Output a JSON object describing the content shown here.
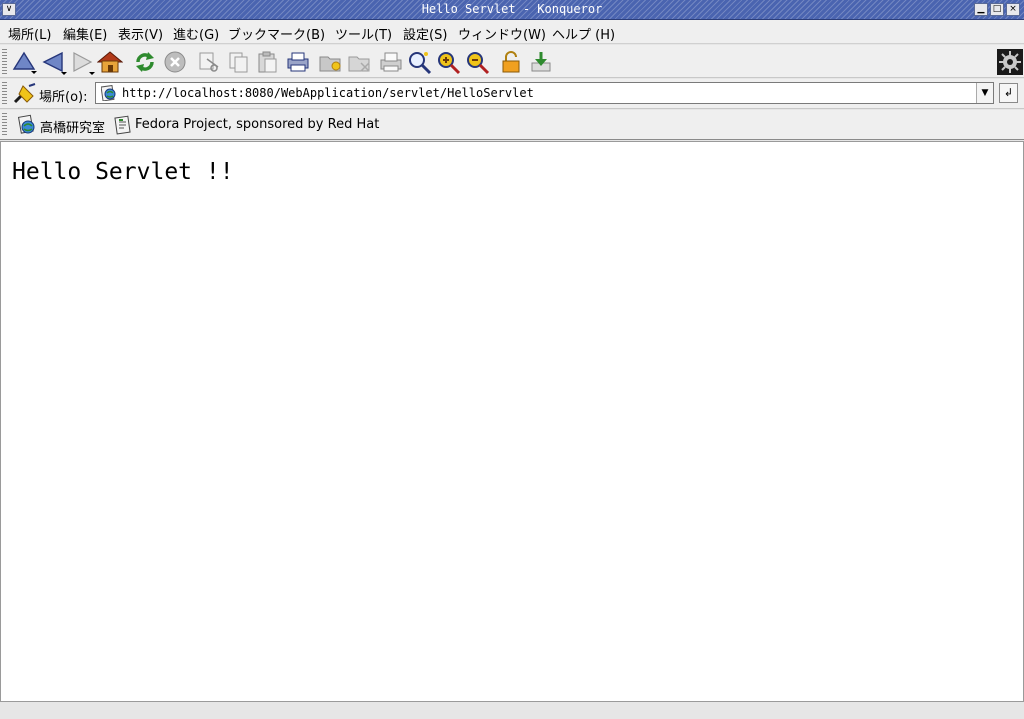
{
  "window": {
    "title": "Hello Servlet - Konqueror",
    "controls": {
      "menu": "∨",
      "minimize": "▁",
      "maximize": "□",
      "close": "×"
    }
  },
  "menubar": {
    "items": [
      "場所(L)",
      "編集(E)",
      "表示(V)",
      "進む(G)",
      "ブックマーク(B)",
      "ツール(T)",
      "設定(S)",
      "ウィンドウ(W)",
      "ヘルプ (H)"
    ]
  },
  "toolbar": {
    "icons": [
      "up-icon",
      "back-icon",
      "forward-icon",
      "home-icon",
      "reload-icon",
      "stop-icon",
      "cut-icon",
      "copy-icon",
      "paste-icon",
      "print-icon",
      "folder-new-icon",
      "folder-icon",
      "printer-icon",
      "find-icon",
      "zoom-in-icon",
      "zoom-out-icon",
      "security-lock-icon",
      "download-icon",
      "throbber-icon"
    ]
  },
  "locationbar": {
    "label": "場所(o):",
    "url": "http://localhost:8080/WebApplication/servlet/HelloServlet",
    "dropdown": "▼",
    "go": "↲"
  },
  "bookmarks": {
    "items": [
      {
        "label": "高橋研究室",
        "icon": "globe-bookmark-icon"
      },
      {
        "label": "Fedora Project, sponsored by Red Hat",
        "icon": "page-bookmark-icon"
      }
    ]
  },
  "page": {
    "heading": "Hello Servlet !!"
  },
  "colors": {
    "titlebar": "#4a64b0",
    "chrome": "#efefef",
    "content_bg": "#ffffff"
  }
}
